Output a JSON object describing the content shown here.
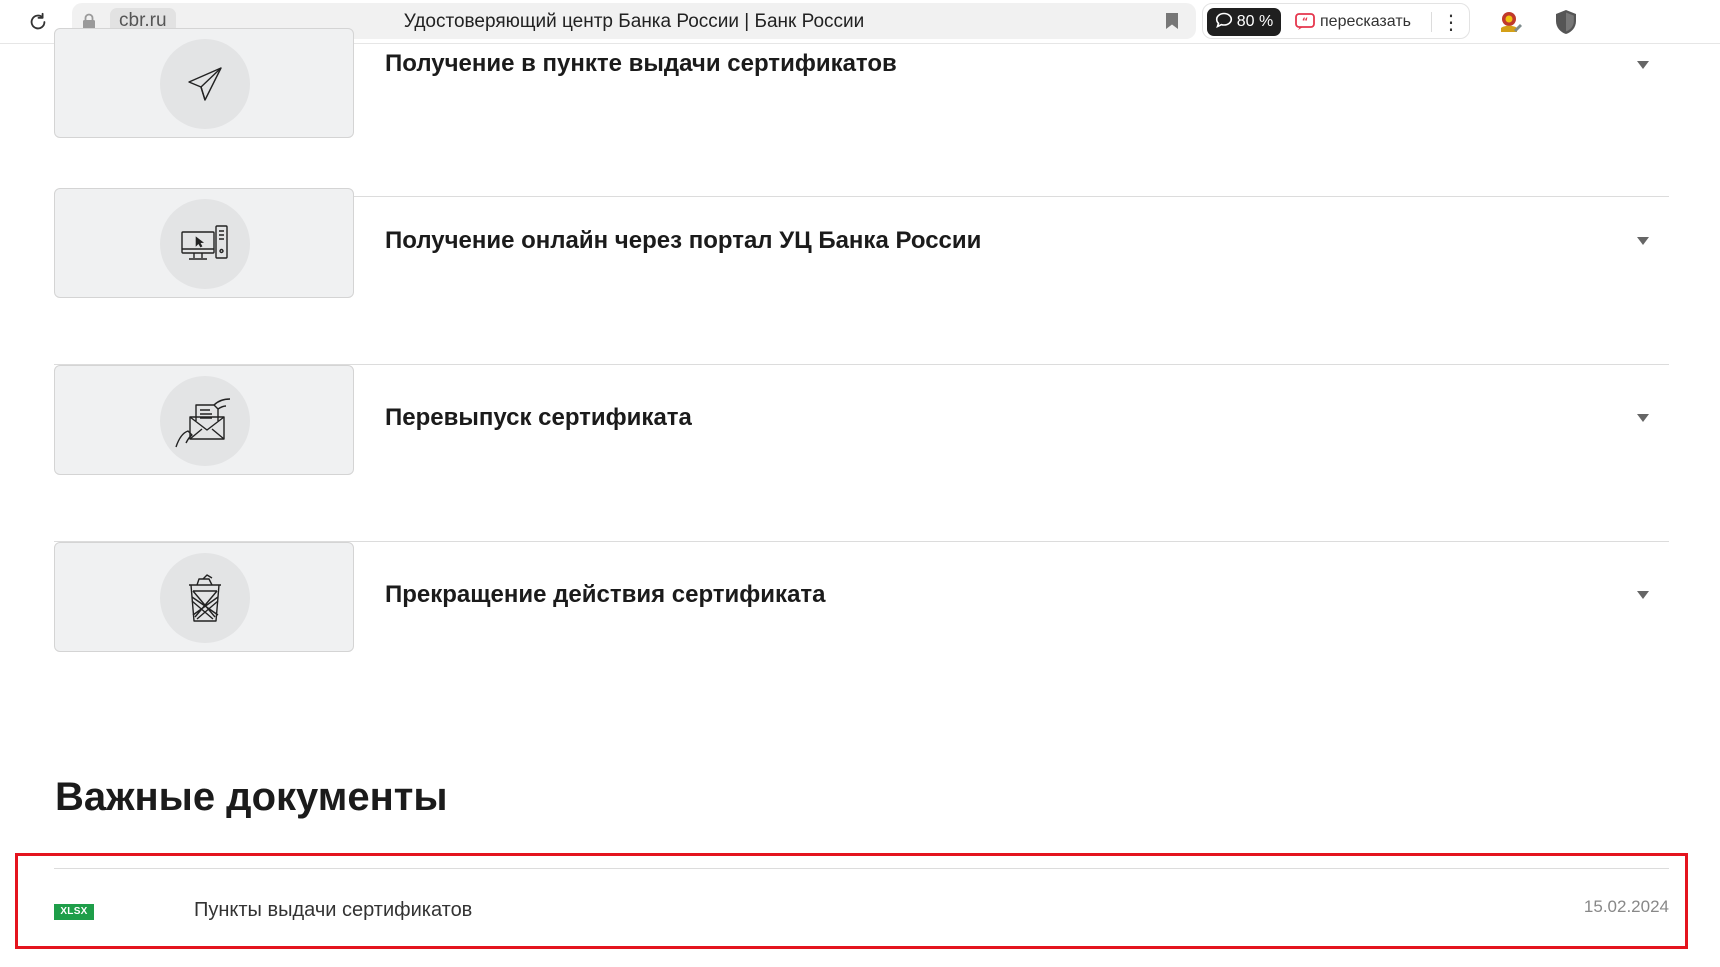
{
  "browser": {
    "domain": "cbr.ru",
    "page_title": "Удостоверяющий центр Банка России | Банк России",
    "rating": "80 %",
    "retell_label": "пересказать",
    "menu_glyph": "⋮"
  },
  "accordion": {
    "items": [
      {
        "title": "Получение в пункте выдачи сертификатов",
        "icon": "paper-plane-icon"
      },
      {
        "title": "Получение онлайн через портал УЦ Банка России",
        "icon": "computer-icon"
      },
      {
        "title": "Перевыпуск сертификата",
        "icon": "envelope-hand-icon"
      },
      {
        "title": "Прекращение действия сертификата",
        "icon": "trash-bin-icon"
      }
    ]
  },
  "documents": {
    "heading": "Важные документы",
    "items": [
      {
        "format": "XLSX",
        "title": "Пункты выдачи сертификатов",
        "date": "15.02.2024"
      }
    ]
  },
  "colors": {
    "highlight": "#e4141e",
    "xlsx_badge": "#1e9e49"
  }
}
